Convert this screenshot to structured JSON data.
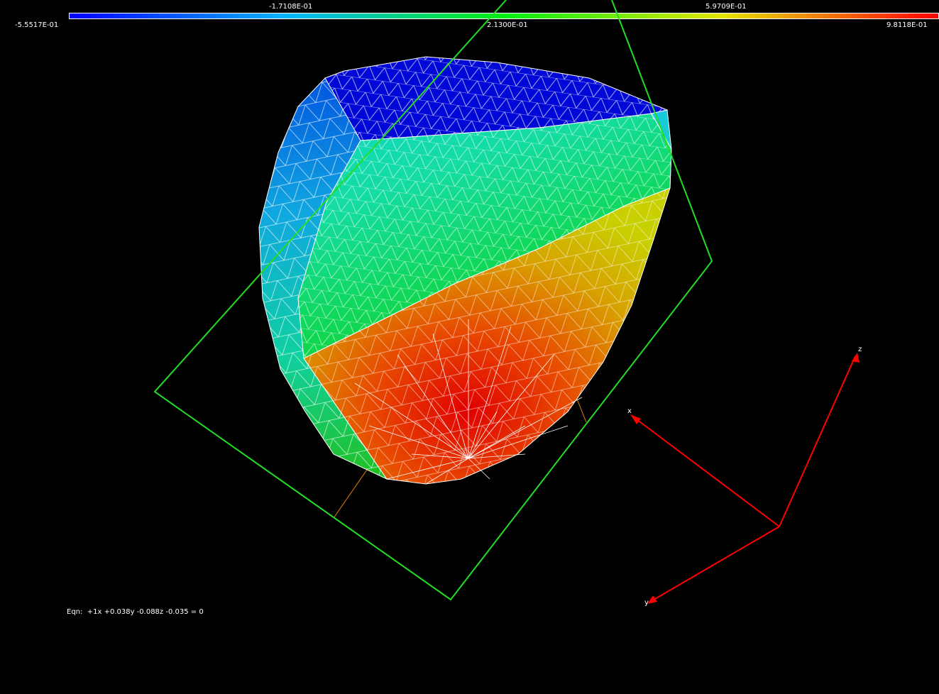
{
  "colorbar": {
    "min_label": "-5.5517E-01",
    "max_label": "9.8118E-01",
    "upper_ticks": [
      "-1.7108E-01",
      "5.9709E-01"
    ],
    "lower_ticks": [
      "-5.5517E-01",
      "2.1300E-01",
      "9.8118E-01"
    ],
    "colors": [
      "#0000ff",
      "#00b5ff",
      "#00ee11",
      "#e6e600",
      "#ff0000"
    ]
  },
  "equation": {
    "label": "Eqn:",
    "text": "+1x +0.038y -0.088z -0.035 = 0"
  },
  "axes": {
    "x_label": "x",
    "y_label": "y",
    "z_label": "z",
    "color": "#ff0000"
  },
  "cutting_plane": {
    "color": "#22dd22"
  },
  "mesh": {
    "wire_color": "#ffffff"
  }
}
